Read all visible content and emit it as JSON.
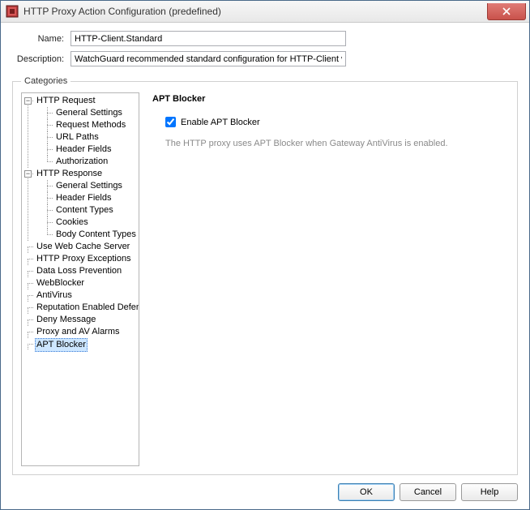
{
  "window": {
    "title": "HTTP Proxy Action Configuration (predefined)"
  },
  "form": {
    "name_label": "Name:",
    "name_value": "HTTP-Client.Standard",
    "desc_label": "Description:",
    "desc_value": "WatchGuard recommended standard configuration for HTTP-Client with logging en"
  },
  "categories": {
    "legend": "Categories",
    "tree": {
      "http_request": {
        "label": "HTTP Request",
        "children": {
          "general": "General Settings",
          "methods": "Request Methods",
          "url_paths": "URL Paths",
          "header_fields": "Header Fields",
          "authorization": "Authorization"
        }
      },
      "http_response": {
        "label": "HTTP Response",
        "children": {
          "general": "General Settings",
          "header_fields": "Header Fields",
          "content_types": "Content Types",
          "cookies": "Cookies",
          "body_content_types": "Body Content Types"
        }
      },
      "use_web_cache": "Use Web Cache Server",
      "http_proxy_exceptions": "HTTP Proxy Exceptions",
      "dlp": "Data Loss Prevention",
      "webblocker": "WebBlocker",
      "antivirus": "AntiVirus",
      "red": "Reputation Enabled Defense",
      "deny_message": "Deny Message",
      "proxy_av_alarms": "Proxy and AV Alarms",
      "apt_blocker": "APT Blocker"
    }
  },
  "detail": {
    "heading": "APT Blocker",
    "checkbox_label": "Enable APT Blocker",
    "checkbox_checked": true,
    "hint": "The HTTP proxy uses APT Blocker when Gateway AntiVirus is enabled."
  },
  "buttons": {
    "ok": "OK",
    "cancel": "Cancel",
    "help": "Help"
  },
  "glyphs": {
    "minus": "−"
  }
}
